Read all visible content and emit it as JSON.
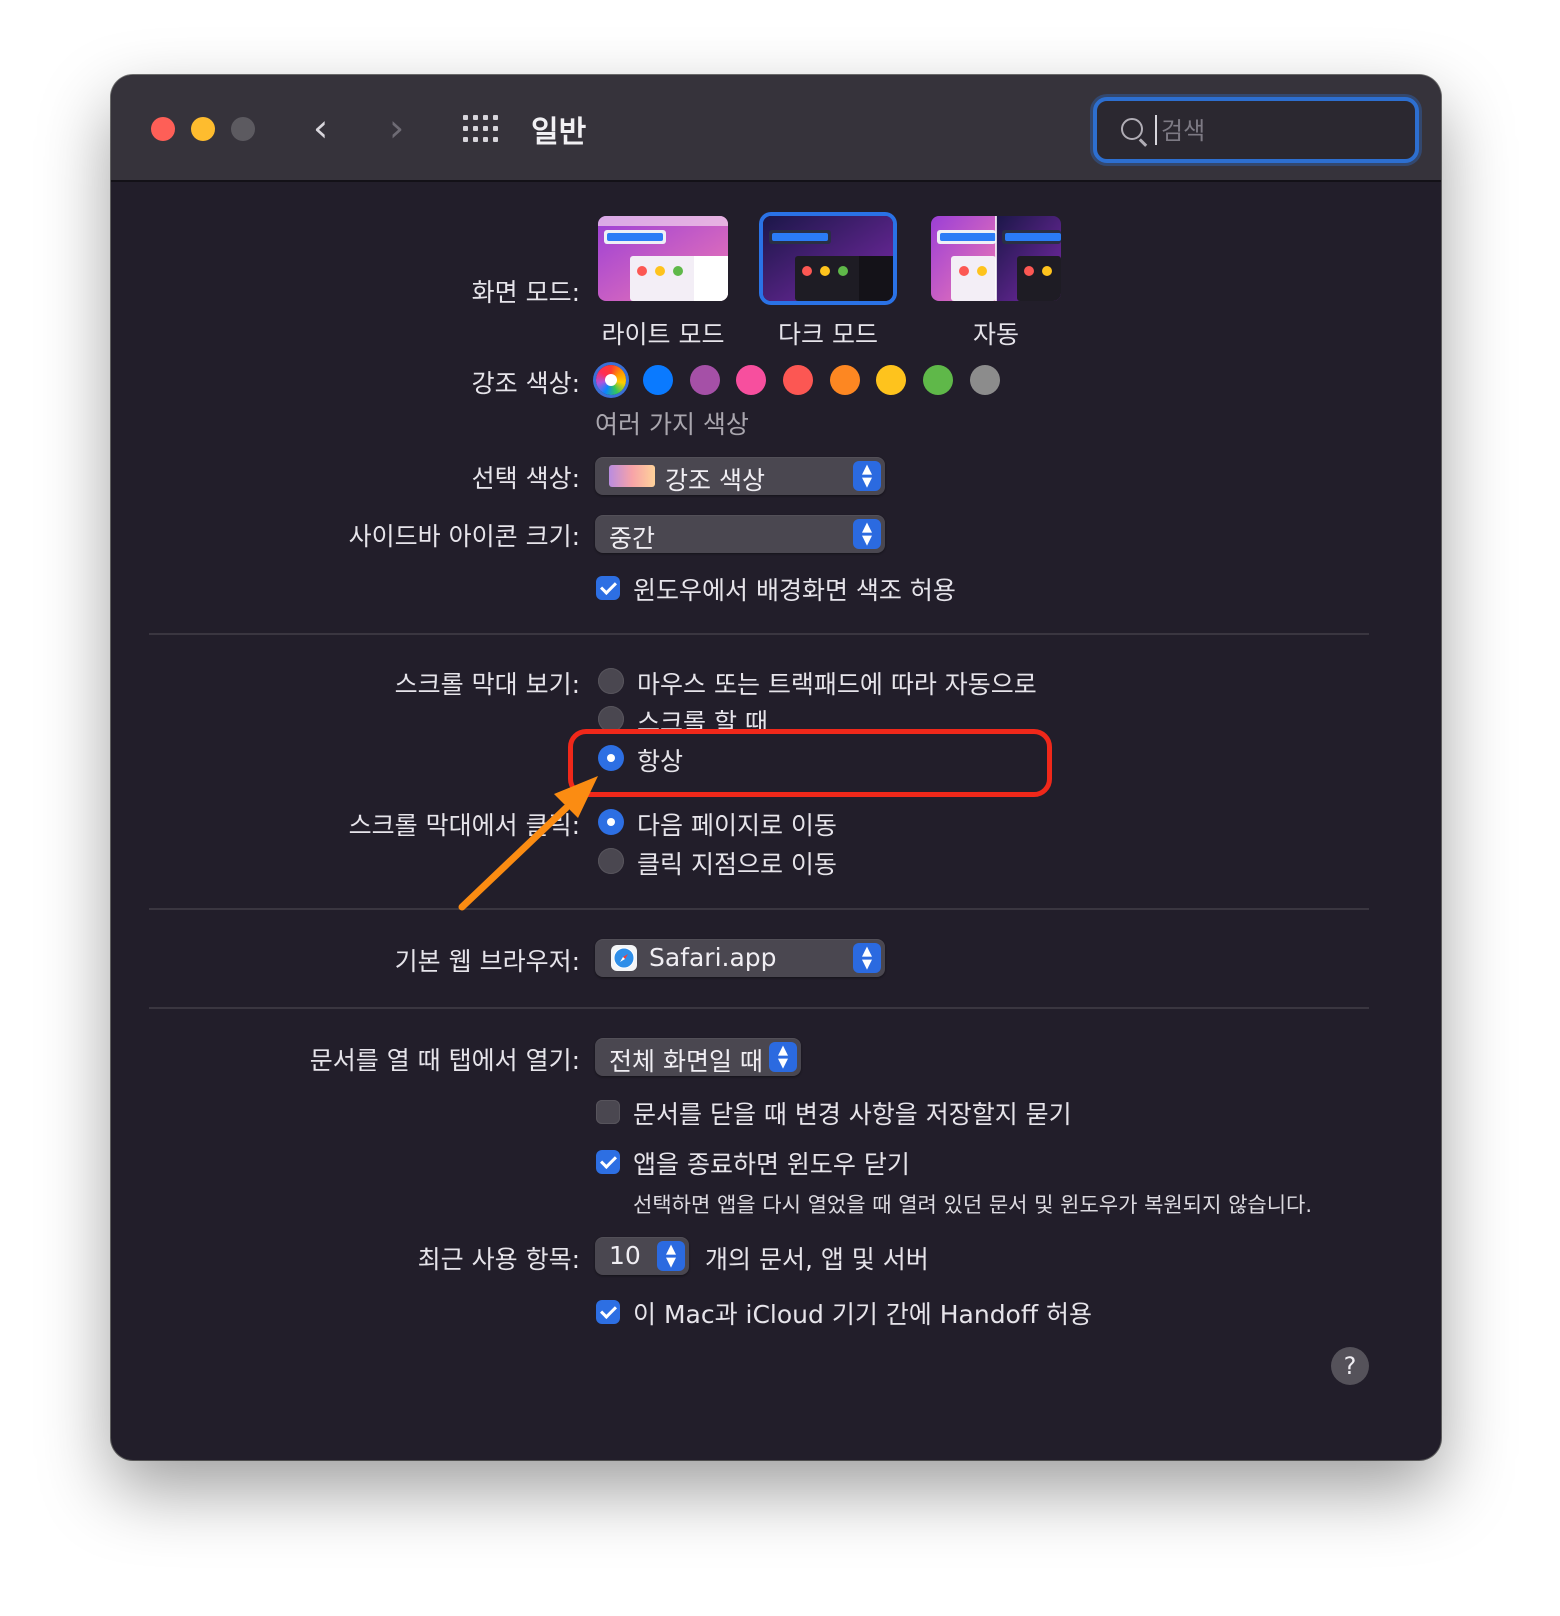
{
  "window": {
    "title": "일반",
    "search": {
      "placeholder": "검색",
      "value": ""
    }
  },
  "appearance": {
    "label": "화면 모드:",
    "options": [
      {
        "name": "라이트 모드",
        "selected": false
      },
      {
        "name": "다크 모드",
        "selected": true
      },
      {
        "name": "자동",
        "selected": false
      }
    ]
  },
  "accent": {
    "label": "강조 색상:",
    "caption": "여러 가지 색상",
    "colors": [
      "multicolor",
      "#0a7aff",
      "#a550a7",
      "#f74f9e",
      "#fc5753",
      "#fd8722",
      "#fec31d",
      "#5fb849",
      "#8c8c8c"
    ],
    "selected": "multicolor"
  },
  "highlight_color": {
    "label": "선택 색상:",
    "value": "강조 색상"
  },
  "sidebar_icon_size": {
    "label": "사이드바 아이콘 크기:",
    "value": "중간"
  },
  "wallpaper_tinting": {
    "label": "윈도우에서 배경화면 색조 허용",
    "checked": true
  },
  "show_scroll_bars": {
    "label": "스크롤 막대 보기:",
    "options": [
      "마우스 또는 트랙패드에 따라 자동으로",
      "스크롤 할 때",
      "항상"
    ],
    "selected": "항상"
  },
  "click_scroll_bar": {
    "label": "스크롤 막대에서 클릭:",
    "options": [
      "다음 페이지로 이동",
      "클릭 지점으로 이동"
    ],
    "selected": "다음 페이지로 이동"
  },
  "default_browser": {
    "label": "기본 웹 브라우저:",
    "value": "Safari.app"
  },
  "prefer_tabs": {
    "label": "문서를 열 때 탭에서 열기:",
    "value": "전체 화면일 때"
  },
  "ask_to_keep_changes": {
    "label": "문서를 닫을 때 변경 사항을 저장할지 묻기",
    "checked": false
  },
  "close_windows": {
    "label": "앱을 종료하면 윈도우 닫기",
    "checked": true,
    "note": "선택하면 앱을 다시 열었을 때 열려 있던 문서 및 윈도우가 복원되지 않습니다."
  },
  "recent_items": {
    "label": "최근 사용 항목:",
    "value": "10",
    "suffix": "개의 문서, 앱 및 서버"
  },
  "handoff": {
    "label": "이 Mac과 iCloud 기기 간에 Handoff 허용",
    "checked": true
  },
  "help": {
    "symbol": "?"
  },
  "annotation": {
    "highlight_color": "#f0281a",
    "arrow_color": "#fb8c12"
  }
}
